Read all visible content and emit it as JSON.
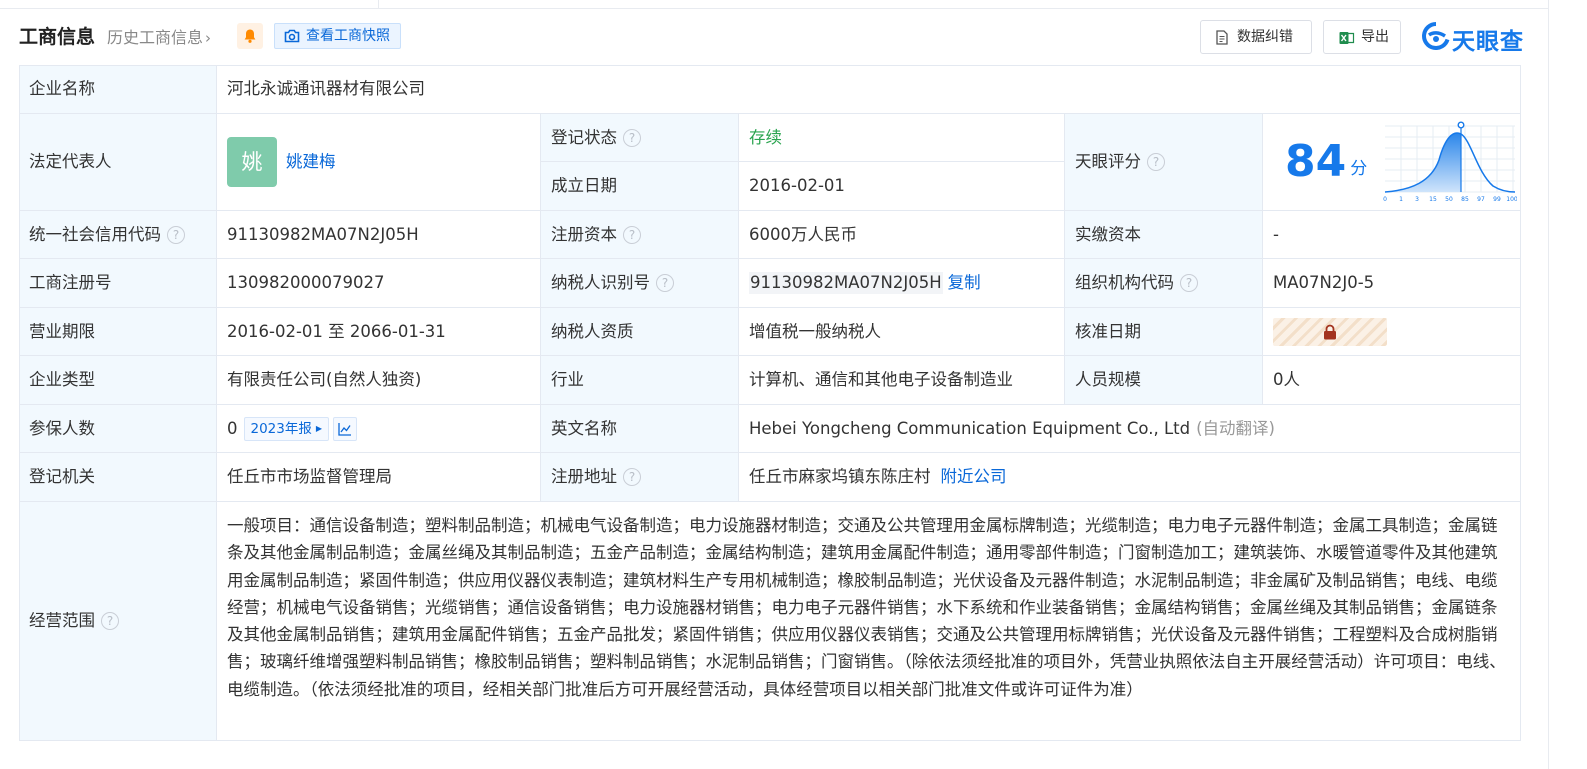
{
  "header": {
    "title": "工商信息",
    "history_label": "历史工商信息",
    "history_chevron": "›",
    "snapshot_label": "查看工商快照",
    "correct_label": "数据纠错",
    "export_label": "导出",
    "brand": "天眼查"
  },
  "table": {
    "company_name": {
      "label": "企业名称",
      "value": "河北永诚通讯器材有限公司"
    },
    "legal_rep": {
      "label": "法定代表人",
      "avatar_char": "姚",
      "name": "姚建梅"
    },
    "reg_status": {
      "label": "登记状态",
      "value": "存续"
    },
    "established": {
      "label": "成立日期",
      "value": "2016-02-01"
    },
    "score": {
      "label": "天眼评分",
      "value": "84",
      "unit": "分",
      "axis_ticks": [
        "0",
        "1",
        "3",
        "15",
        "50",
        "85",
        "97",
        "99",
        "100"
      ]
    },
    "credit_code": {
      "label": "统一社会信用代码",
      "value": "91130982MA07N2J05H"
    },
    "reg_capital": {
      "label": "注册资本",
      "value": "6000万人民币"
    },
    "paid_capital": {
      "label": "实缴资本",
      "value": "-"
    },
    "reg_no": {
      "label": "工商注册号",
      "value": "130982000079027"
    },
    "taxpayer_id": {
      "label": "纳税人识别号",
      "value": "91130982MA07N2J05H",
      "copy_label": "复制"
    },
    "org_code": {
      "label": "组织机构代码",
      "value": "MA07N2J0-5"
    },
    "term": {
      "label": "营业期限",
      "value": "2016-02-01 至 2066-01-31"
    },
    "taxpayer_qual": {
      "label": "纳税人资质",
      "value": "增值税一般纳税人"
    },
    "approval_date": {
      "label": "核准日期"
    },
    "company_type": {
      "label": "企业类型",
      "value": "有限责任公司(自然人独资)"
    },
    "industry": {
      "label": "行业",
      "value": "计算机、通信和其他电子设备制造业"
    },
    "staff_size": {
      "label": "人员规模",
      "value": "0人"
    },
    "insured": {
      "label": "参保人数",
      "value": "0",
      "year_label": "2023年报"
    },
    "english_name": {
      "label": "英文名称",
      "value": "Hebei Yongcheng Communication Equipment Co., Ltd",
      "note": "(自动翻译)"
    },
    "reg_authority": {
      "label": "登记机关",
      "value": "任丘市市场监督管理局"
    },
    "reg_address": {
      "label": "注册地址",
      "value": "任丘市麻家坞镇东陈庄村",
      "nearby_label": "附近公司"
    },
    "scope": {
      "label": "经营范围",
      "value": "一般项目：通信设备制造；塑料制品制造；机械电气设备制造；电力设施器材制造；交通及公共管理用金属标牌制造；光缆制造；电力电子元器件制造；金属工具制造；金属链条及其他金属制品制造；金属丝绳及其制品制造；五金产品制造；金属结构制造；建筑用金属配件制造；通用零部件制造；门窗制造加工；建筑装饰、水暖管道零件及其他建筑用金属制品制造；紧固件制造；供应用仪器仪表制造；建筑材料生产专用机械制造；橡胶制品制造；光伏设备及元器件制造；水泥制品制造；非金属矿及制品销售；电线、电缆经营；机械电气设备销售；光缆销售；通信设备销售；电力设施器材销售；电力电子元器件销售；水下系统和作业装备销售；金属结构销售；金属丝绳及其制品销售；金属链条及其他金属制品销售；建筑用金属配件销售；五金产品批发；紧固件销售；供应用仪器仪表销售；交通及公共管理用标牌销售；光伏设备及元器件销售；工程塑料及合成树脂销售；玻璃纤维增强塑料制品销售；橡胶制品销售；塑料制品销售；水泥制品销售；门窗销售。（除依法须经批准的项目外，凭营业执照依法自主开展经营活动）许可项目：电线、电缆制造。（依法须经批准的项目，经相关部门批准后方可开展经营活动，具体经营项目以相关部门批准文件或许可证件为准）"
    }
  },
  "colors": {
    "accent": "#1679ea",
    "label_bg": "#f2f9fe",
    "status_green": "#2aa44f",
    "avatar_bg": "#7fcbab"
  },
  "icons": [
    "bell-icon",
    "camera-icon",
    "document-icon",
    "excel-icon",
    "logo-icon",
    "help-icon",
    "lock-icon",
    "trend-icon"
  ]
}
